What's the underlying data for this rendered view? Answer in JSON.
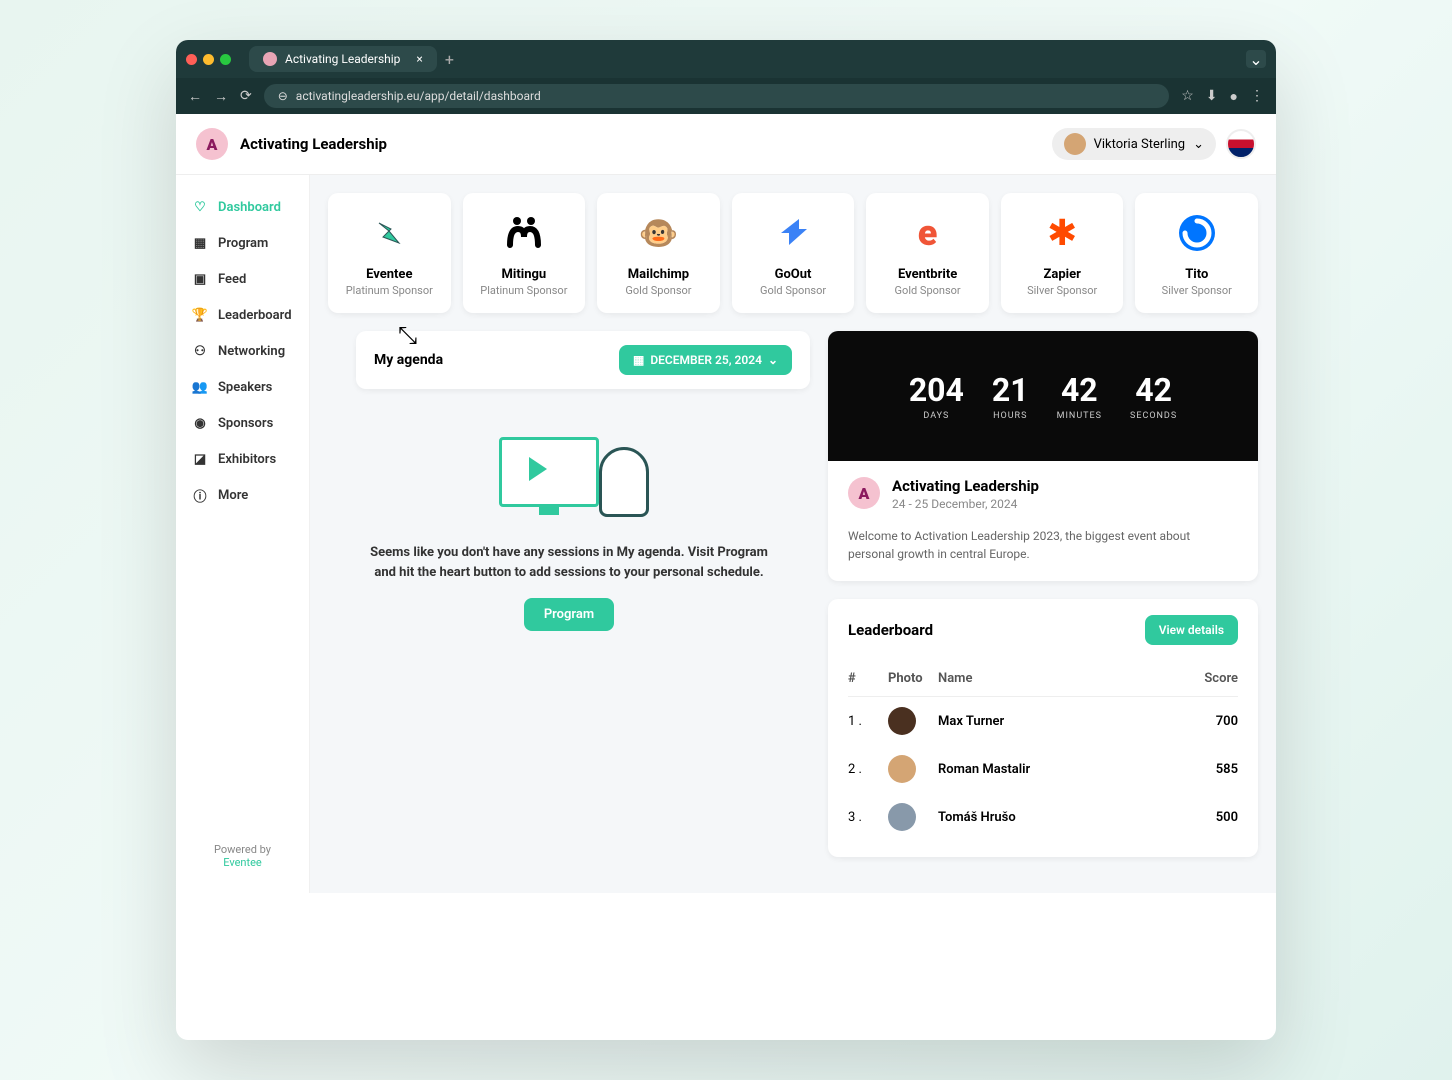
{
  "browser": {
    "tab_title": "Activating Leadership",
    "url": "activatingleadership.eu/app/detail/dashboard"
  },
  "header": {
    "app_title": "Activating Leadership",
    "user_name": "Viktoria Sterling"
  },
  "sidebar": {
    "items": [
      {
        "label": "Dashboard",
        "active": true
      },
      {
        "label": "Program"
      },
      {
        "label": "Feed"
      },
      {
        "label": "Leaderboard"
      },
      {
        "label": "Networking"
      },
      {
        "label": "Speakers"
      },
      {
        "label": "Sponsors"
      },
      {
        "label": "Exhibitors"
      },
      {
        "label": "More"
      }
    ],
    "powered_text": "Powered by",
    "powered_link": "Eventee"
  },
  "sponsors": [
    {
      "name": "Eventee",
      "tier": "Platinum Sponsor"
    },
    {
      "name": "Mitingu",
      "tier": "Platinum Sponsor"
    },
    {
      "name": "Mailchimp",
      "tier": "Gold Sponsor"
    },
    {
      "name": "GoOut",
      "tier": "Gold Sponsor"
    },
    {
      "name": "Eventbrite",
      "tier": "Gold Sponsor"
    },
    {
      "name": "Zapier",
      "tier": "Silver Sponsor"
    },
    {
      "name": "Tito",
      "tier": "Silver Sponsor"
    }
  ],
  "agenda": {
    "title": "My agenda",
    "date_label": "DECEMBER 25, 2024",
    "empty_text": "Seems like you don't have any sessions in My agenda. Visit Program and hit the heart button to add sessions to your personal schedule.",
    "program_btn": "Program"
  },
  "countdown": {
    "days": "204",
    "days_label": "DAYS",
    "hours": "21",
    "hours_label": "HOURS",
    "minutes": "42",
    "minutes_label": "MINUTES",
    "seconds": "42",
    "seconds_label": "SECONDS"
  },
  "event": {
    "title": "Activating Leadership",
    "date": "24 - 25 December, 2024",
    "description": "Welcome to Activation Leadership 2023, the biggest event about personal growth in central Europe."
  },
  "leaderboard": {
    "title": "Leaderboard",
    "view_btn": "View details",
    "cols": {
      "rank": "#",
      "photo": "Photo",
      "name": "Name",
      "score": "Score"
    },
    "rows": [
      {
        "rank": "1 .",
        "name": "Max Turner",
        "score": "700"
      },
      {
        "rank": "2 .",
        "name": "Roman Mastalir",
        "score": "585"
      },
      {
        "rank": "3 .",
        "name": "Tomáš Hrušo",
        "score": "500"
      }
    ]
  }
}
